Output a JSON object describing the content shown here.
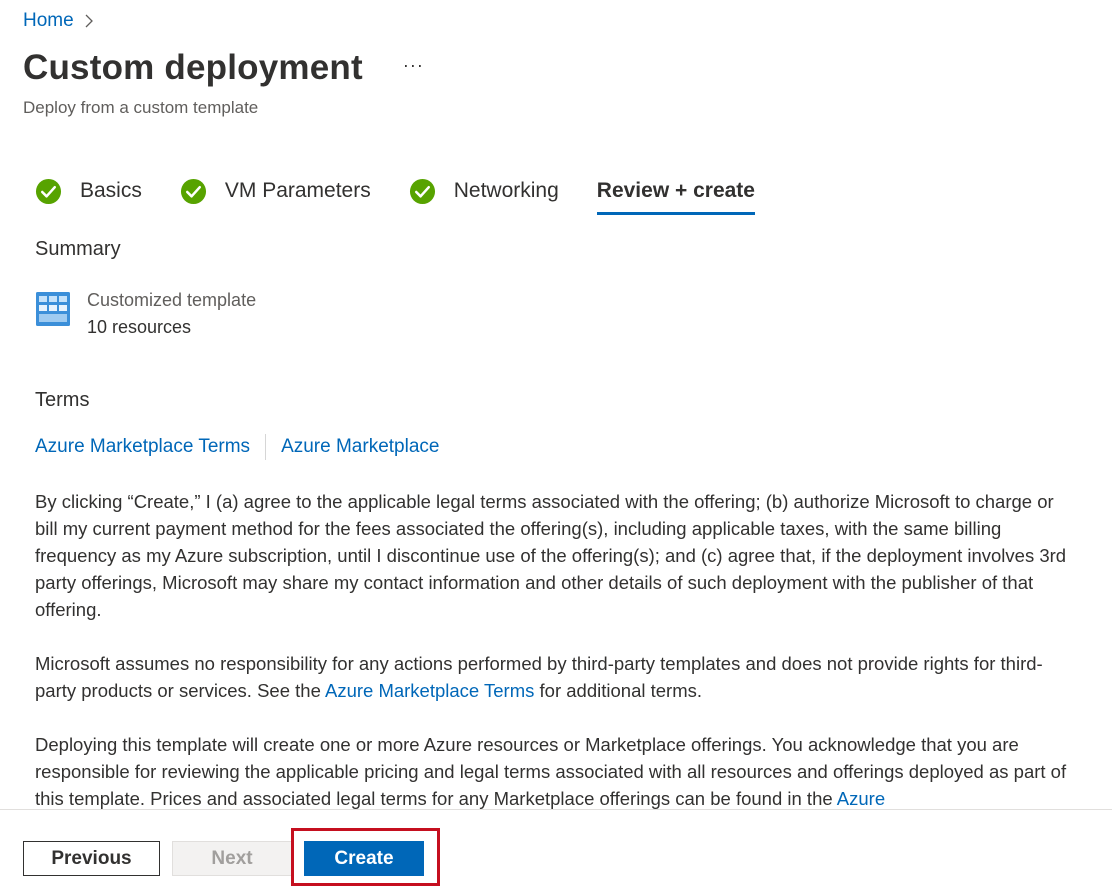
{
  "breadcrumb": {
    "home": "Home"
  },
  "page": {
    "title": "Custom deployment",
    "more": "···",
    "subtitle": "Deploy from a custom template"
  },
  "tabs": [
    {
      "label": "Basics",
      "completed": true,
      "icon": "check-circle-icon"
    },
    {
      "label": "VM Parameters",
      "completed": true,
      "icon": "check-circle-icon"
    },
    {
      "label": "Networking",
      "completed": true,
      "icon": "check-circle-icon"
    },
    {
      "label": "Review + create",
      "active": true
    }
  ],
  "summary": {
    "heading": "Summary",
    "icon": "template-icon",
    "template_label": "Customized template",
    "resources": "10 resources"
  },
  "terms": {
    "heading": "Terms",
    "links": [
      "Azure Marketplace Terms",
      "Azure Marketplace"
    ],
    "p1": "By clicking “Create,” I (a) agree to the applicable legal terms associated with the offering; (b) authorize Microsoft to charge or bill my current payment method for the fees associated the offering(s), including applicable taxes, with the same billing frequency as my Azure subscription, until I discontinue use of the offering(s); and (c) agree that, if the deployment involves 3rd party offerings, Microsoft may share my contact information and other details of such deployment with the publisher of that offering.",
    "p2_before": "Microsoft assumes no responsibility for any actions performed by third-party templates and does not provide rights for third-party products or services. See the ",
    "p2_link": "Azure Marketplace Terms",
    "p2_after": " for additional terms.",
    "p3_text": "Deploying this template will create one or more Azure resources or Marketplace offerings.  You acknowledge that you are responsible for reviewing the applicable pricing and legal terms associated with all resources and offerings deployed as part of this template.  Prices and associated legal terms for any Marketplace offerings can be found in the ",
    "p3_link": "Azure"
  },
  "footer": {
    "previous": "Previous",
    "next": "Next",
    "create": "Create"
  },
  "colors": {
    "accent": "#0067b8",
    "success": "#57a300",
    "highlight": "#c50f1f"
  }
}
